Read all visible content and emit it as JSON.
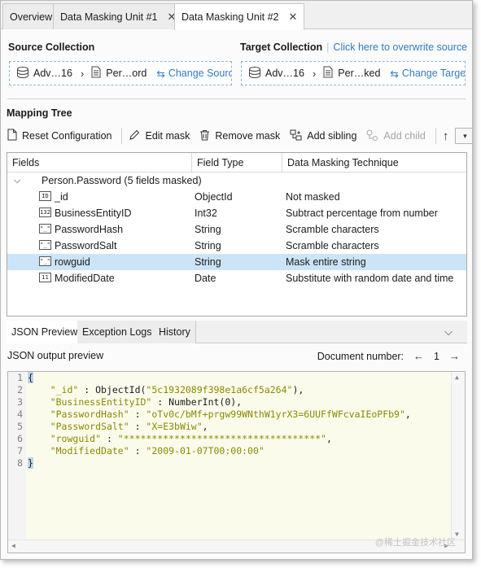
{
  "tabs": [
    {
      "label": "Overview"
    },
    {
      "label": "Data Masking Unit #1",
      "close": "✕"
    },
    {
      "label": "Data Masking Unit #2",
      "close": "✕"
    }
  ],
  "source": {
    "title": "Source Collection",
    "db": "Adv…16",
    "coll": "Per…ord",
    "change": "Change Source"
  },
  "target": {
    "title": "Target Collection",
    "overwrite_link": "Click here to overwrite source",
    "db": "Adv…16",
    "coll": "Per…ked",
    "change": "Change Target"
  },
  "mapping": {
    "title": "Mapping Tree",
    "toolbar": {
      "reset": "Reset Configuration",
      "edit": "Edit mask",
      "remove": "Remove mask",
      "add_sibling": "Add sibling",
      "add_child": "Add child"
    },
    "columns": [
      "Fields",
      "Field Type",
      "Data Masking Technique"
    ],
    "root": "Person.Password (5 fields masked)",
    "rows": [
      {
        "icon": "id",
        "field": "_id",
        "type": "ObjectId",
        "technique": "Not masked"
      },
      {
        "icon": "i32",
        "field": "BusinessEntityID",
        "type": "Int32",
        "technique": "Subtract percentage from number"
      },
      {
        "icon": "str",
        "field": "PasswordHash",
        "type": "String",
        "technique": "Scramble characters"
      },
      {
        "icon": "str",
        "field": "PasswordSalt",
        "type": "String",
        "technique": "Scramble characters"
      },
      {
        "icon": "str",
        "field": "rowguid",
        "type": "String",
        "technique": "Mask entire string"
      },
      {
        "icon": "date",
        "field": "ModifiedDate",
        "type": "Date",
        "technique": "Substitute with random date and time"
      }
    ]
  },
  "bottom_tabs": [
    "JSON Preview",
    "Exception Logs",
    "History"
  ],
  "json_preview": {
    "label": "JSON output preview",
    "doc_label": "Document number:",
    "doc_number": "1",
    "prev": "←",
    "next": "→",
    "line_numbers": [
      "1",
      "2",
      "3",
      "4",
      "5",
      "6",
      "7",
      "8"
    ],
    "open_brace": "{",
    "close_brace": "}",
    "entries": [
      {
        "key": "\"_id\"",
        "sep": " : ObjectId(",
        "value": "\"5c1932089f398e1a6cf5a264\"",
        "tail": "),"
      },
      {
        "key": "\"BusinessEntityID\"",
        "sep": " : NumberInt(0),",
        "value": "",
        "tail": ""
      },
      {
        "key": "\"PasswordHash\"",
        "sep": " : ",
        "value": "\"oTv0c/bMf+prgw99WNthW1yrX3=6UUFfWFcvaIEoPFb9\"",
        "tail": ","
      },
      {
        "key": "\"PasswordSalt\"",
        "sep": " : ",
        "value": "\"X=E3bWiw\"",
        "tail": ","
      },
      {
        "key": "\"rowguid\"",
        "sep": " : ",
        "value": "\"***********************************\"",
        "tail": ","
      },
      {
        "key": "\"ModifiedDate\"",
        "sep": " : ",
        "value": "\"2009-01-07T00:00:00\"",
        "tail": ""
      }
    ]
  },
  "watermark": "@稀土掘金技术社区",
  "colors": {
    "accent": "#2f7bc4",
    "selection": "#cce4f7",
    "json_value": "#8a8a00"
  }
}
